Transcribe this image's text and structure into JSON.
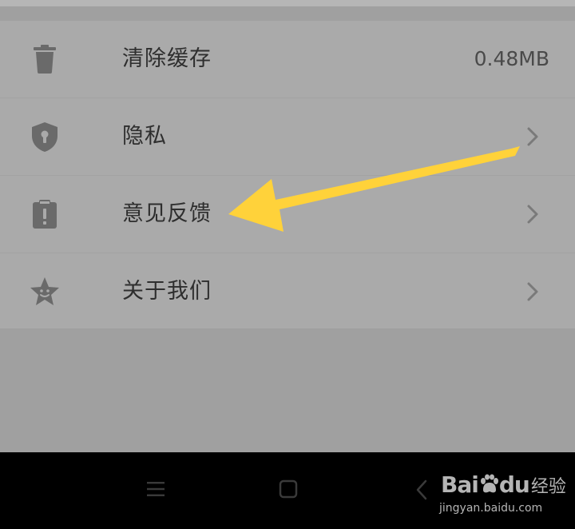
{
  "settings": {
    "items": [
      {
        "label": "清除缓存",
        "value": "0.48MB",
        "icon": "trash-icon"
      },
      {
        "label": "隐私",
        "icon": "shield-lock-icon"
      },
      {
        "label": "意见反馈",
        "icon": "feedback-clipboard-icon"
      },
      {
        "label": "关于我们",
        "icon": "star-face-icon"
      }
    ]
  },
  "nav": {
    "menu": "☰"
  },
  "watermark": {
    "brand_left": "Bai",
    "brand_right": "du",
    "product": "经验",
    "url": "jingyan.baidu.com"
  },
  "colors": {
    "arrow": "#ffd23a",
    "icon": "#6a6a6a",
    "background": "#aaaaaa"
  }
}
